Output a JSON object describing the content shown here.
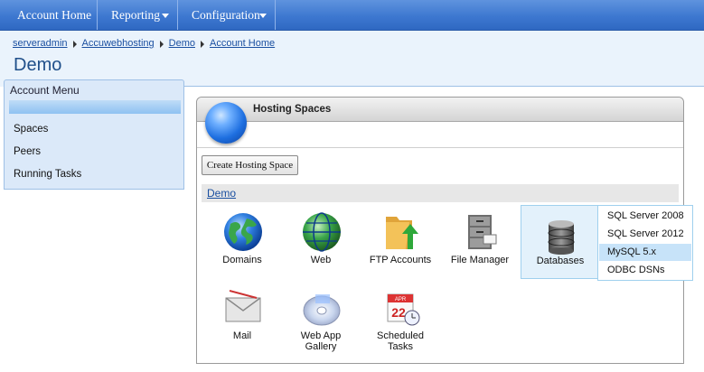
{
  "nav": {
    "items": [
      {
        "label": "Account Home"
      },
      {
        "label": "Reporting"
      },
      {
        "label": "Configuration"
      }
    ]
  },
  "breadcrumb": [
    "serveradmin",
    "Accuwebhosting",
    "Demo",
    "Account Home"
  ],
  "page_title": "Demo",
  "account_menu": {
    "title": "Account Menu",
    "items": [
      "Spaces",
      "Peers",
      "Running Tasks"
    ]
  },
  "hosting": {
    "title": "Hosting Spaces",
    "create_button": "Create Hosting Space",
    "space_name": "Demo",
    "tiles": [
      {
        "label": "Domains",
        "icon": "globe-icon"
      },
      {
        "label": "Web",
        "icon": "web-globe-icon"
      },
      {
        "label": "FTP Accounts",
        "icon": "folder-upload-icon"
      },
      {
        "label": "File Manager",
        "icon": "file-cabinet-icon"
      },
      {
        "label": "Databases",
        "icon": "database-icon"
      },
      {
        "label": "Mail",
        "icon": "envelope-icon"
      },
      {
        "label": "Web App Gallery",
        "icon": "cd-icon"
      },
      {
        "label": "Scheduled Tasks",
        "icon": "calendar-clock-icon"
      }
    ],
    "calendar_month": "APR",
    "calendar_day": "22"
  },
  "db_menu": {
    "options": [
      "SQL Server 2008",
      "SQL Server 2012",
      "MySQL 5.x",
      "ODBC DSNs"
    ],
    "highlighted": "MySQL 5.x"
  },
  "colors": {
    "nav_blue": "#3d78d0",
    "link_blue": "#1a4fa0",
    "band_bg": "#eaf3fc",
    "highlight": "#c7e3f9"
  }
}
